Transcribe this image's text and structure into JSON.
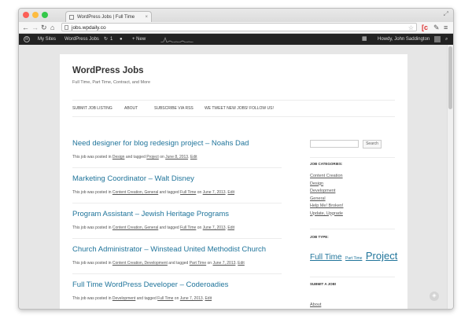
{
  "browser": {
    "tab_title": "WordPress Jobs | Full Time",
    "url": "jobs.wpdaily.co",
    "colors": {
      "close": "#fc5f57",
      "minimize": "#fdbc40",
      "zoom": "#34c84a"
    }
  },
  "admin_bar": {
    "my_sites": "My Sites",
    "site_name": "WordPress Jobs",
    "updates_count": "1",
    "new_label": "+ New",
    "howdy": "Howdy, John Saddington"
  },
  "site": {
    "title": "WordPress Jobs",
    "tagline": "Full Time, Part Time, Contract, and More",
    "nav": [
      "SUBMIT JOB LISTING",
      "ABOUT",
      "SUBSCRIBE VIA RSS",
      "WE TWEET NEW JOBS! FOLLOW US!"
    ]
  },
  "posts": [
    {
      "title": "Need designer for blog redesign project – Noahs Dad",
      "t1": "This job was posted in ",
      "cats": "Design",
      "t2": " and tagged ",
      "tags": "Project",
      "t3": " on ",
      "date": "June 8, 2013",
      "t4": ". ",
      "edit": "Edit"
    },
    {
      "title": "Marketing Coordinator – Walt Disney",
      "t1": "This job was posted in ",
      "cats": "Content Creation, General",
      "t2": " and tagged ",
      "tags": "Full Time",
      "t3": " on ",
      "date": "June 7, 2013",
      "t4": ". ",
      "edit": "Edit"
    },
    {
      "title": "Program Assistant – Jewish Heritage Programs",
      "t1": "This job was posted in ",
      "cats": "Content Creation, General",
      "t2": " and tagged ",
      "tags": "Full Time",
      "t3": " on ",
      "date": "June 7, 2013",
      "t4": ". ",
      "edit": "Edit"
    },
    {
      "title": "Church Administrator – Winstead United Methodist Church",
      "t1": "This job was posted in ",
      "cats": "Content Creation, Development",
      "t2": " and tagged ",
      "tags": "Part Time",
      "t3": " on ",
      "date": "June 7, 2013",
      "t4": ". ",
      "edit": "Edit"
    },
    {
      "title": "Full Time WordPress Developer – Coderoadies",
      "t1": "This job was posted in ",
      "cats": "Development",
      "t2": " and tagged ",
      "tags": "Full Time",
      "t3": " on ",
      "date": "June 7, 2013",
      "t4": ". ",
      "edit": "Edit"
    }
  ],
  "sidebar": {
    "search_button": "Search",
    "categories_title": "JOB CATEGORIES:",
    "categories": [
      "Content Creation",
      "Design",
      "Development",
      "General",
      "Help Me! Broken!",
      "Update, Upgrade"
    ],
    "types_title": "JOB TYPE:",
    "types": [
      "Full Time",
      "Part Time",
      "Project"
    ],
    "submit_title": "SUBMIT A JOB!",
    "about": "About"
  }
}
